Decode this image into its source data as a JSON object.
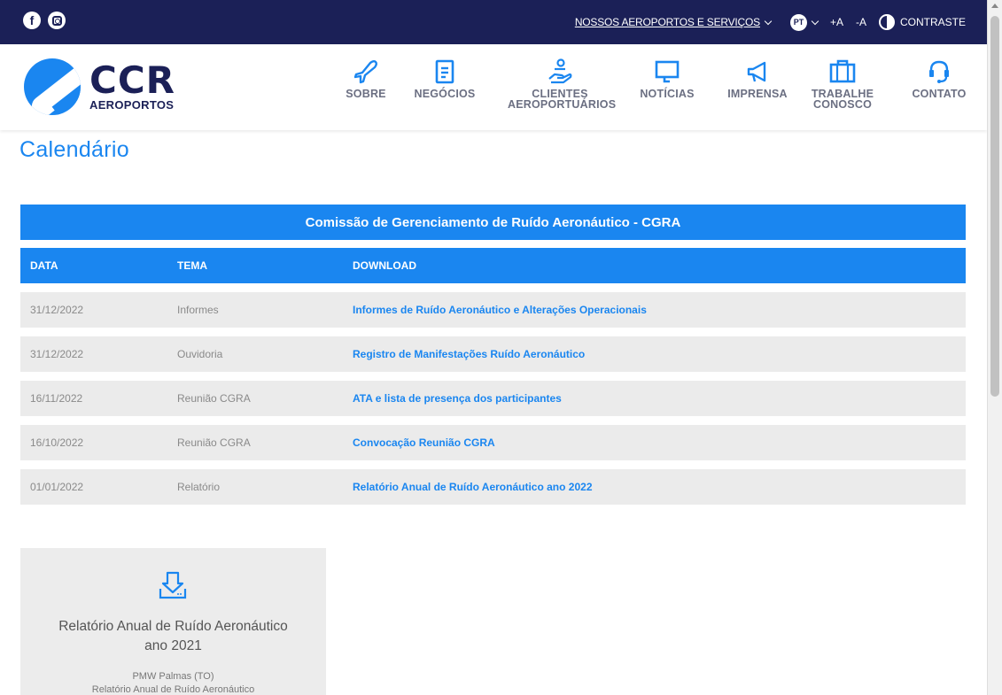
{
  "topbar": {
    "social": [
      {
        "icon": "facebook-icon",
        "glyph": "f"
      },
      {
        "icon": "instagram-icon"
      }
    ],
    "airports_link": "NOSSOS AEROPORTOS E SERVIÇOS",
    "lang": "PT",
    "font_plus": "+A",
    "font_minus": "-A",
    "contrast": "CONTRASTE"
  },
  "logo": {
    "big": "CCR",
    "small": "AEROPORTOS"
  },
  "nav": [
    {
      "label": "SOBRE",
      "icon": "airplane-icon"
    },
    {
      "label": "NEGÓCIOS",
      "icon": "document-icon"
    },
    {
      "label": "CLIENTES AEROPORTUÁRIOS",
      "icon": "hand-coin-icon"
    },
    {
      "label": "NOTÍCIAS",
      "icon": "monitor-icon"
    },
    {
      "label": "IMPRENSA",
      "icon": "megaphone-icon"
    },
    {
      "label": "TRABALHE CONOSCO",
      "icon": "briefcase-icon"
    },
    {
      "label": "CONTATO",
      "icon": "headset-icon"
    }
  ],
  "page_title": "Calendário",
  "table": {
    "title": "Comissão de Gerenciamento de Ruído Aeronáutico - CGRA",
    "headers": [
      "DATA",
      "TEMA",
      "DOWNLOAD"
    ],
    "rows": [
      [
        "31/12/2022",
        "Informes",
        "Informes de Ruído Aeronáutico e Alterações Operacionais"
      ],
      [
        "31/12/2022",
        "Ouvidoria",
        "Registro de Manifestações Ruído Aeronáutico"
      ],
      [
        "16/11/2022",
        "Reunião CGRA",
        "ATA e lista de presença dos participantes"
      ],
      [
        "16/10/2022",
        "Reunião CGRA",
        "Convocação Reunião CGRA"
      ],
      [
        "01/01/2022",
        "Relatório",
        "Relatório Anual de Ruído Aeronáutico ano 2022"
      ]
    ]
  },
  "card": {
    "icon": "download-icon",
    "title_line1": "Relatório Anual de Ruído Aeronáutico",
    "title_line2": "ano 2021",
    "sub1": "PMW Palmas (TO)",
    "sub2": "Relatório Anual de Ruído Aeronáutico"
  },
  "colors": {
    "navy": "#1b2057",
    "accent": "#1a86f0",
    "row_bg": "#ebebeb"
  }
}
